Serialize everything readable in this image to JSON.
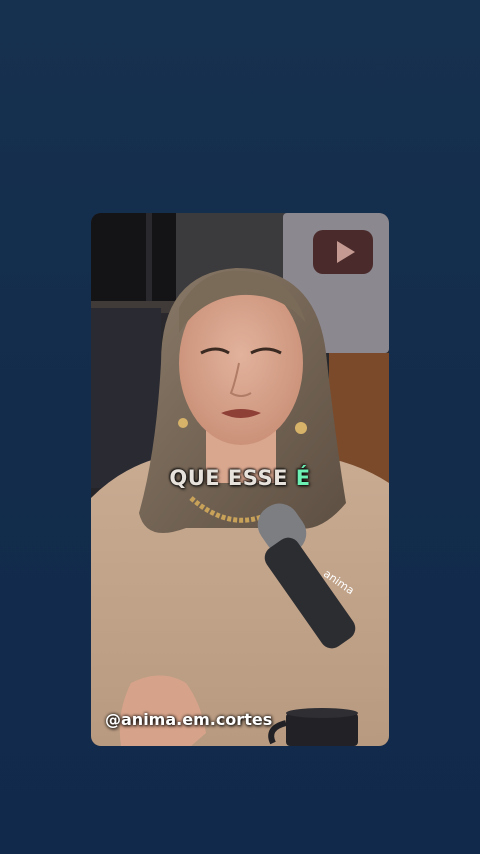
{
  "video": {
    "caption_main": "QUE ESSE ",
    "caption_highlight": "É",
    "handle": "@anima.em.cortes",
    "mic_brand": "anima"
  },
  "colors": {
    "page_background": "#132c4c",
    "caption_text": "#e7e2dc",
    "caption_highlight": "#6df0b4",
    "handle_text": "#ffffff"
  },
  "icons": {
    "background_logo": "youtube-play-button-icon"
  }
}
